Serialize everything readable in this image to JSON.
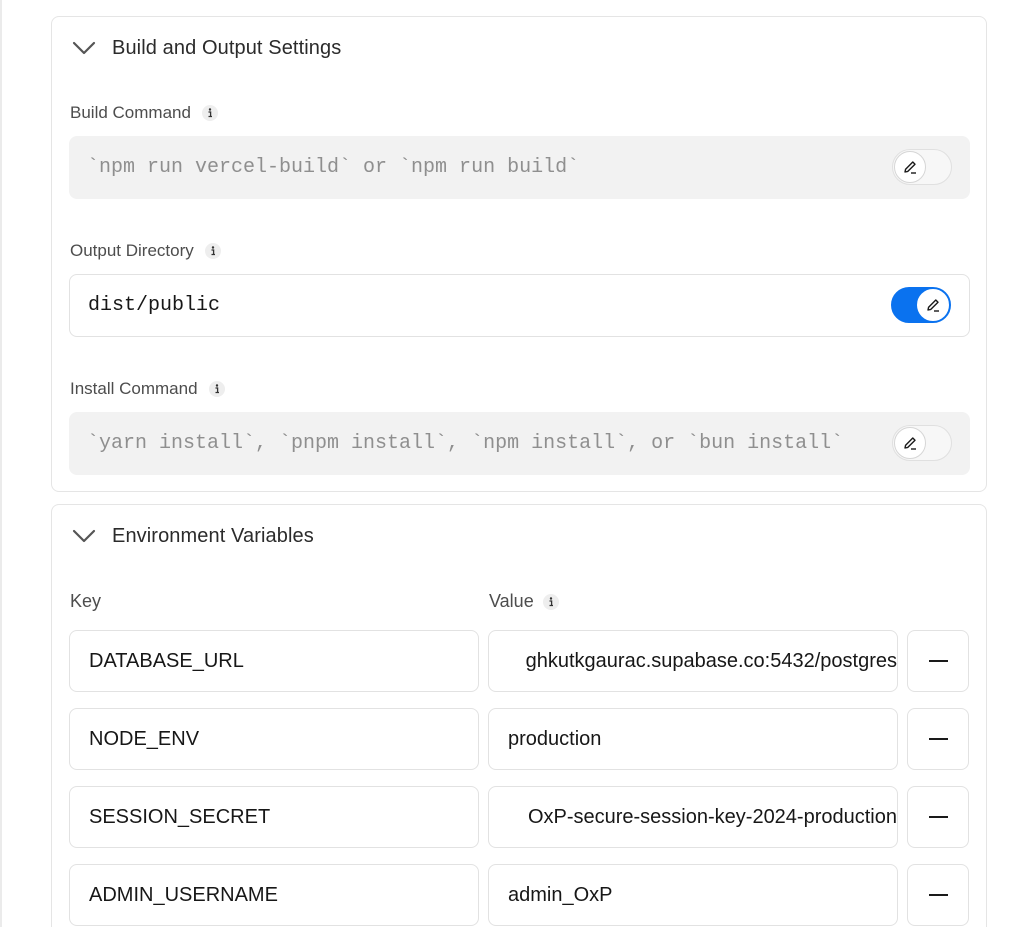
{
  "build_section": {
    "title": "Build and Output Settings",
    "chevron_icon": "chevron-down-icon",
    "fields": [
      {
        "label": "Build Command",
        "value": "`npm run vercel-build` or `npm run build`",
        "override_enabled": false
      },
      {
        "label": "Output Directory",
        "value": "dist/public",
        "override_enabled": true
      },
      {
        "label": "Install Command",
        "value": "`yarn install`, `pnpm install`, `npm install`, or `bun install`",
        "override_enabled": false
      }
    ]
  },
  "env_section": {
    "title": "Environment Variables",
    "chevron_icon": "chevron-down-icon",
    "key_header": "Key",
    "value_header": "Value",
    "rows": [
      {
        "key": "DATABASE_URL",
        "value": "ghkutkgaurac.supabase.co:5432/postgres"
      },
      {
        "key": "NODE_ENV",
        "value": "production"
      },
      {
        "key": "SESSION_SECRET",
        "value": "OxP-secure-session-key-2024-production"
      },
      {
        "key": "ADMIN_USERNAME",
        "value": "admin_OxP"
      }
    ]
  },
  "colors": {
    "accent": "#0a72ef",
    "disabled_bg": "#f2f2f2",
    "border": "#e5e5e5"
  }
}
